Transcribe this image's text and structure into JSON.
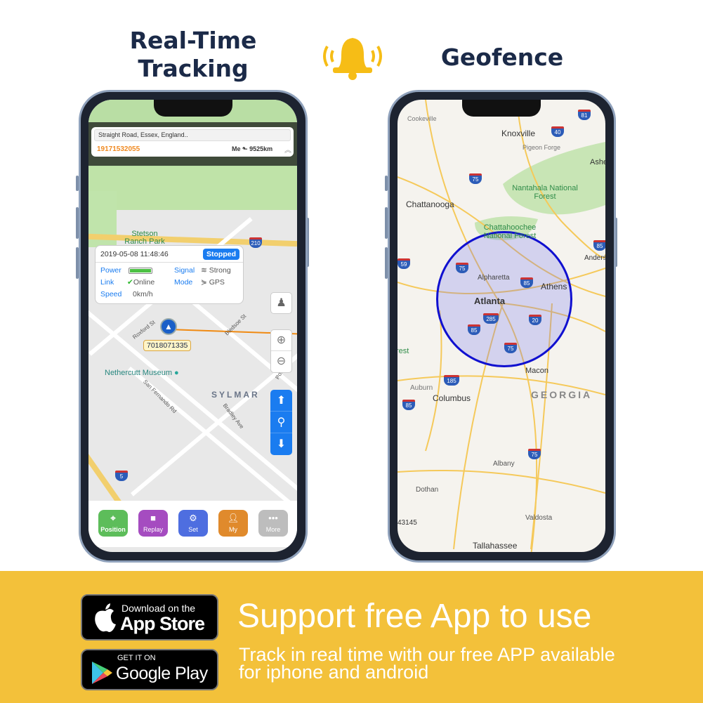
{
  "headings": {
    "left_line1": "Real-Time",
    "left_line2": "Tracking",
    "right": "Geofence"
  },
  "icons": {
    "bell": "bell-icon",
    "bell_color": "#f6bd16"
  },
  "tracking_app": {
    "address": "Straight Road, Essex, England..",
    "phone_number": "19171532055",
    "me_label": "Me",
    "distance": "9525km",
    "popup": {
      "datetime": "2019-05-08 11:48:46",
      "status": "Stopped",
      "power_label": "Power",
      "signal_label": "Signal",
      "signal_value": "Strong",
      "link_label": "Link",
      "link_value": "Online",
      "mode_label": "Mode",
      "mode_value": "GPS",
      "speed_label": "Speed",
      "speed_value": "0km/h",
      "battery_level": 1.0
    },
    "device_id": "7018071335",
    "map_labels": {
      "park": "Stetson Ranch Park",
      "museum": "Nethercutt Museum",
      "area": "SYLMAR",
      "roxford": "Roxford St",
      "bledsoe": "Bledsoe St",
      "san_fernando": "San Fernando Rd",
      "bradley": "Bradley Ave",
      "polk": "Polk St",
      "hwy210": "210",
      "hwy5": "5"
    },
    "tabs": [
      {
        "label": "Position",
        "color": "#5dbd5a"
      },
      {
        "label": "Replay",
        "color": "#a54cc0"
      },
      {
        "label": "Set",
        "color": "#4e6ee0"
      },
      {
        "label": "My",
        "color": "#e08a2c"
      },
      {
        "label": "More",
        "color": "#bdbdbd"
      }
    ],
    "accent": "#1a7cf0"
  },
  "geofence_map": {
    "labels": {
      "cookeville": "Cookeville",
      "knoxville": "Knoxville",
      "pigeon_forge": "Pigeon Forge",
      "ashe": "Ashe",
      "nantahala": "Nantahala National Forest",
      "chattanooga": "Chattanooga",
      "chattahoochee": "Chattahoochee National Forest",
      "alpharetta": "Alpharetta",
      "athens": "Athens",
      "atlanta": "Atlanta",
      "anders": "Anders",
      "macon": "Macon",
      "georgia": "GEORGIA",
      "auburn": "Auburn",
      "columbus": "Columbus",
      "albany": "Albany",
      "dothan": "Dothan",
      "valdosta": "Valdosta",
      "tallahassee": "Tallahassee",
      "partial_number": "43145",
      "partial_forest": "rest"
    },
    "shields": [
      "75",
      "40",
      "81",
      "85",
      "59",
      "75",
      "85",
      "285",
      "20",
      "85",
      "75",
      "185",
      "85",
      "75"
    ],
    "fence_color": "#1010d0"
  },
  "banner": {
    "title": "Support free App to use",
    "subtitle_line1": "Track in real time with our free APP available",
    "subtitle_line2": "for iphone and android",
    "bg": "#f3c13a"
  },
  "badges": {
    "appstore_small": "Download on the",
    "appstore_big": "App Store",
    "play_small": "GET IT ON",
    "play_big": "Google Play"
  }
}
